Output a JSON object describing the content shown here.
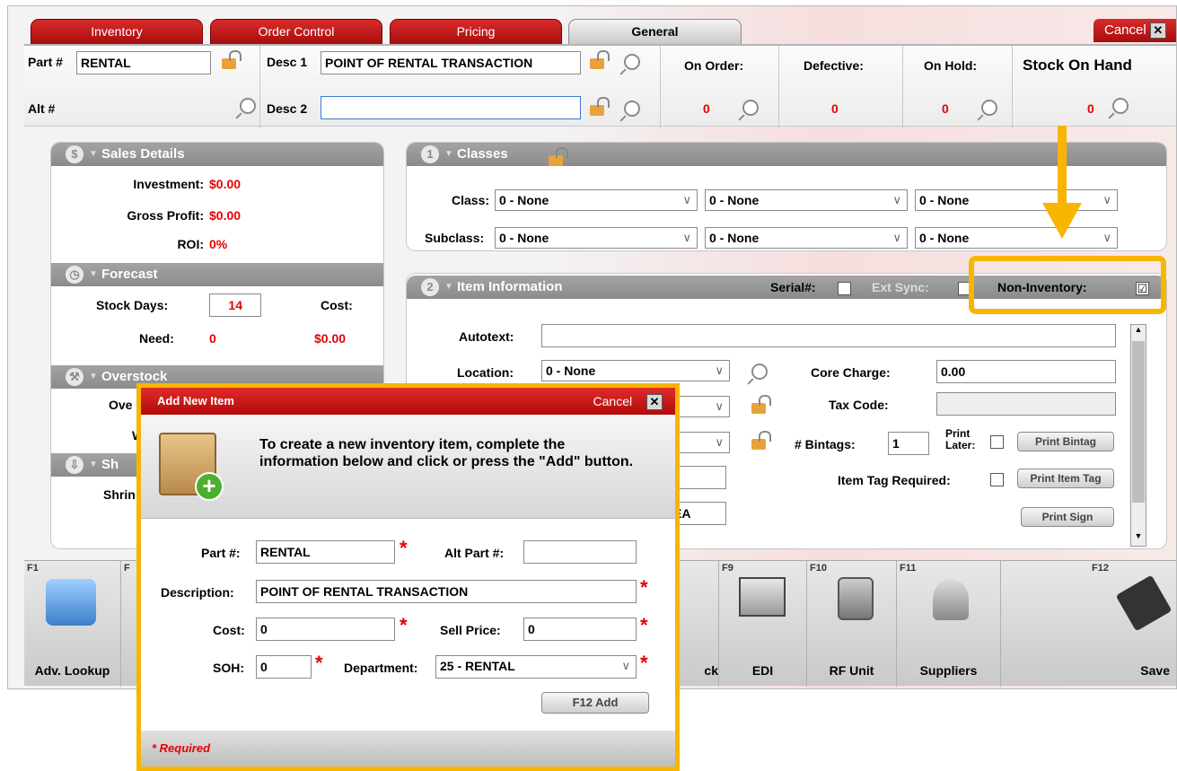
{
  "tabs": {
    "inventory": "Inventory",
    "order_control": "Order Control",
    "pricing": "Pricing",
    "general": "General",
    "cancel": "Cancel"
  },
  "header": {
    "part_label": "Part #",
    "part_value": "RENTAL",
    "alt_label": "Alt #",
    "desc1_label": "Desc 1",
    "desc1_value": "POINT OF RENTAL TRANSACTION",
    "desc2_label": "Desc 2",
    "desc2_value": "",
    "on_order_label": "On Order:",
    "on_order_value": "0",
    "defective_label": "Defective:",
    "defective_value": "0",
    "on_hold_label": "On Hold:",
    "on_hold_value": "0",
    "stock_label": "Stock On Hand",
    "stock_value": "0"
  },
  "sales": {
    "title": "Sales Details",
    "investment_label": "Investment:",
    "investment_value": "$0.00",
    "gross_label": "Gross Profit:",
    "gross_value": "$0.00",
    "roi_label": "ROI:",
    "roi_value": "0%"
  },
  "forecast": {
    "title": "Forecast",
    "stock_days_label": "Stock Days:",
    "stock_days_value": "14",
    "cost_label": "Cost:",
    "need_label": "Need:",
    "need_value": "0",
    "cost_value": "$0.00"
  },
  "overstock": {
    "title": "Overstock",
    "row1": "Ove",
    "row2": "W"
  },
  "shrink": {
    "title": "Sh",
    "row1": "Shrin"
  },
  "classes": {
    "title": "Classes",
    "class_label": "Class:",
    "subclass_label": "Subclass:",
    "values": [
      "0 - None",
      "0 - None",
      "0 - None"
    ],
    "sub_values": [
      "0 - None",
      "0 - None",
      "0 - None"
    ]
  },
  "item_info": {
    "title": "Item Information",
    "serial_label": "Serial#:",
    "ext_sync_label": "Ext Sync:",
    "non_inventory_label": "Non-Inventory:",
    "non_inventory_checked": "☑",
    "autotext_label": "Autotext:",
    "location_label": "Location:",
    "location_value": "0 - None",
    "core_label": "Core Charge:",
    "core_value": "0.00",
    "tax_label": "Tax Code:",
    "bintags_label": "# Bintags:",
    "bintags_value": "1",
    "print_later_label": "Print Later:",
    "print_bintag": "Print Bintag",
    "item_tag_label": "Item Tag Required:",
    "print_item_tag": "Print Item Tag",
    "print_sign": "Print Sign",
    "uom_value": "EA"
  },
  "fkeys": [
    {
      "key": "F1",
      "label": "Adv. Lookup"
    },
    {
      "key": "F",
      "label": ""
    },
    {
      "key": "",
      "label": "ck"
    },
    {
      "key": "F9",
      "label": "EDI"
    },
    {
      "key": "F10",
      "label": "RF Unit"
    },
    {
      "key": "F11",
      "label": "Suppliers"
    },
    {
      "key": "F12",
      "label": "Save"
    }
  ],
  "modal": {
    "title": "Add New Item",
    "cancel": "Cancel",
    "instructions": "To create a new inventory item, complete the information below and click or press the \"Add\" button.",
    "part_label": "Part #:",
    "part_value": "RENTAL",
    "alt_label": "Alt Part #:",
    "alt_value": "",
    "desc_label": "Description:",
    "desc_value": "POINT OF RENTAL TRANSACTION",
    "cost_label": "Cost:",
    "cost_value": "0",
    "sell_label": "Sell Price:",
    "sell_value": "0",
    "soh_label": "SOH:",
    "soh_value": "0",
    "dept_label": "Department:",
    "dept_value": "25 - RENTAL",
    "add_button": "F12  Add",
    "required_note": "* Required"
  },
  "colors": {
    "accent_red": "#c41414",
    "value_red": "#e60000",
    "highlight": "#f7b500"
  }
}
